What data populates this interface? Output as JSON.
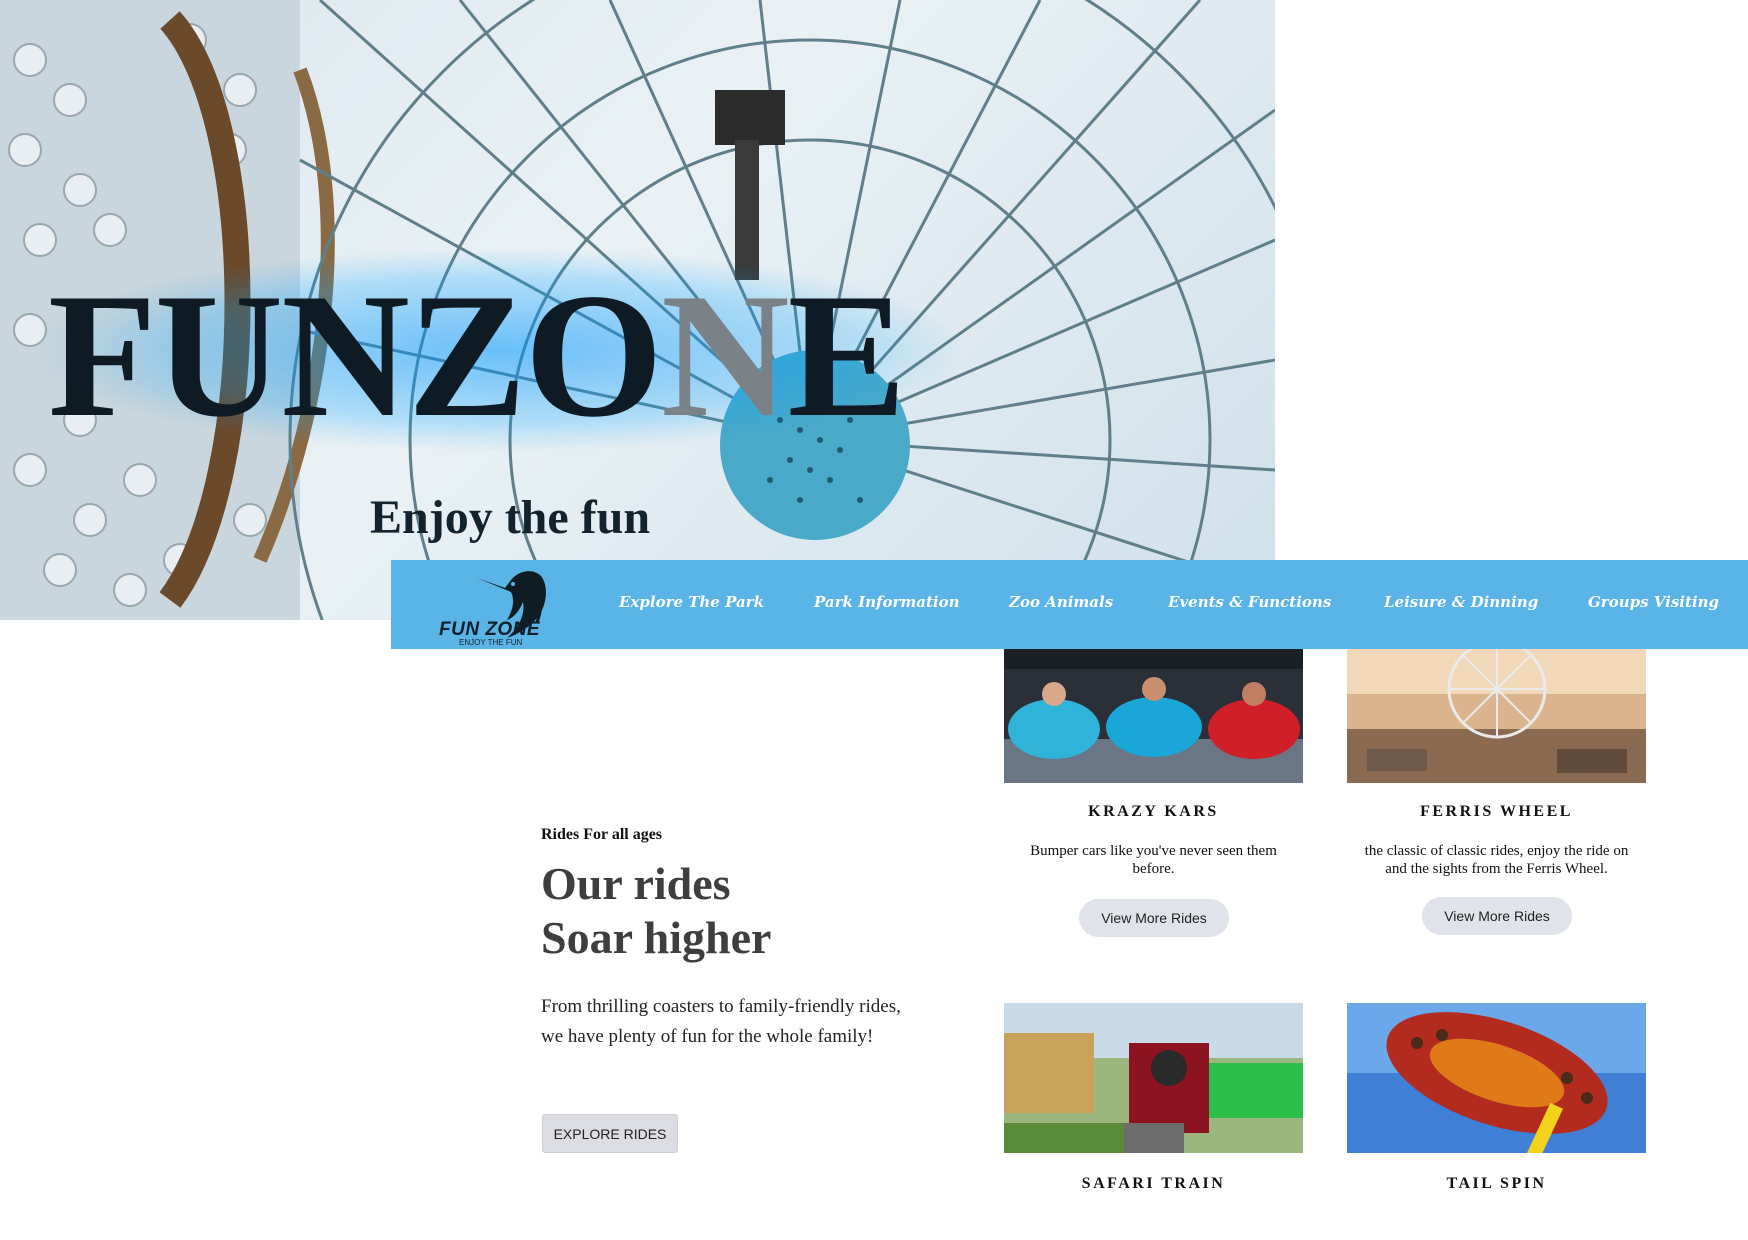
{
  "hero": {
    "title_main": "FUNZO",
    "title_dim": "N",
    "title_end": "E",
    "subtitle": "Enjoy the fun"
  },
  "nav": {
    "logo_text": "FUN ZONE",
    "logo_tagline": "ENJOY THE FUN",
    "items": [
      "Explore The Park",
      "Park Information",
      "Zoo Animals",
      "Events & Functions",
      "Leisure & Dinning",
      "Groups Visiting"
    ]
  },
  "rides": {
    "eyebrow": "Rides For all ages",
    "heading_line1": "Our rides",
    "heading_line2": "Soar higher",
    "description": "From thrilling coasters to family-friendly rides, we have plenty of fun for the whole family!",
    "explore_label": "EXPLORE RIDES"
  },
  "cards": [
    {
      "title": "KRAZY KARS",
      "description": "Bumper cars like you've never seen them before.",
      "button_label": "View More Rides"
    },
    {
      "title": "FERRIS WHEEL",
      "description": "the classic of classic rides, enjoy the ride on and the sights from the Ferris Wheel.",
      "button_label": "View More Rides"
    },
    {
      "title": "SAFARI TRAIN"
    },
    {
      "title": "TAIL SPIN"
    }
  ],
  "colors": {
    "nav_background": "#5bb4e8",
    "hero_glow": "#0096ff",
    "button_gray": "#dcdde3"
  }
}
